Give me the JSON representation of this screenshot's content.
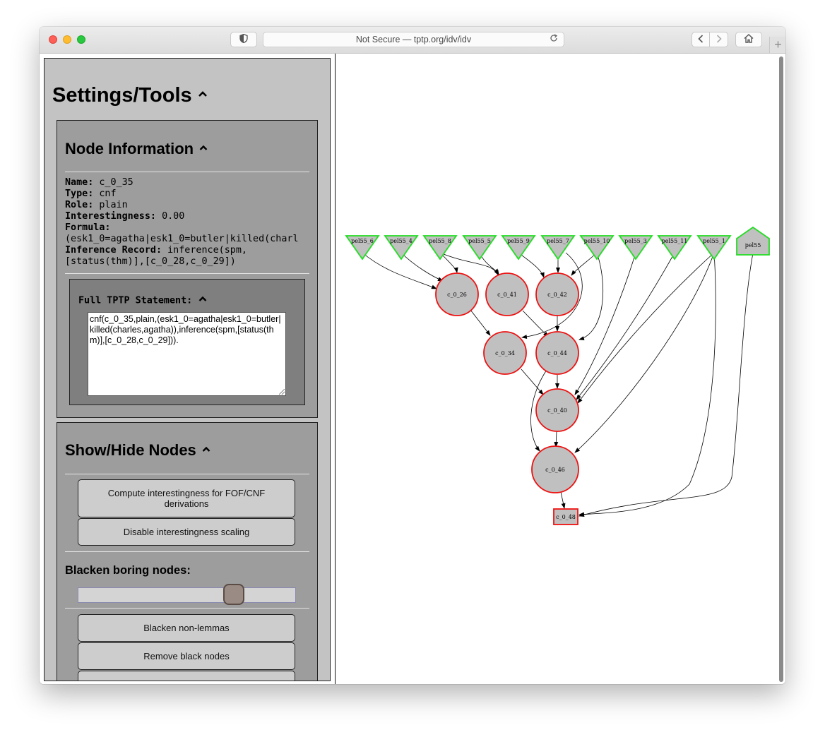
{
  "browser": {
    "url": "Not Secure — tptp.org/idv/idv",
    "shield_icon": "shield-icon",
    "reload_icon": "reload-icon",
    "back_icon": "chevron-left-icon",
    "forward_icon": "chevron-right-icon",
    "home_icon": "home-icon",
    "new_tab_label": "+"
  },
  "settings": {
    "title": "Settings/Tools",
    "node_info": {
      "title": "Node Information",
      "name_label": "Name:",
      "name_value": "c_0_35",
      "type_label": "Type:",
      "type_value": "cnf",
      "role_label": "Role:",
      "role_value": "plain",
      "interestingness_label": "Interestingness:",
      "interestingness_value": "0.00",
      "formula_label": "Formula:",
      "formula_value": "(esk1_0=agatha|esk1_0=butler|killed(charl",
      "inference_label": "Inference Record:",
      "inference_value_1": "inference(spm,",
      "inference_value_2": "[status(thm)],[c_0_28,c_0_29])",
      "full_tptp_title": "Full TPTP Statement:",
      "full_tptp_text": "cnf(c_0_35,plain,(esk1_0=agatha|esk1_0=butler|killed(charles,agatha)),inference(spm,[status(thm)],[c_0_28,c_0_29]))."
    },
    "show_hide": {
      "title": "Show/Hide Nodes",
      "compute_button": "Compute interestingness for FOF/CNF derivations",
      "disable_button": "Disable interestingness scaling",
      "blacken_label": "Blacken boring nodes:",
      "blacken_level_percent": 71,
      "blacken_nonlemmas_button": "Blacken non-lemmas",
      "remove_black_button": "Remove black nodes"
    }
  },
  "graph": {
    "top_nodes": [
      "pel55_6",
      "pel55_4",
      "pel55_8",
      "pel55_5",
      "pel55_9",
      "pel55_7",
      "pel55_10",
      "pel55_3",
      "pel55_11",
      "pel55_1"
    ],
    "conjecture_node": "pel55",
    "circle_nodes": [
      "c_0_26",
      "c_0_41",
      "c_0_42",
      "c_0_34",
      "c_0_44",
      "c_0_40",
      "c_0_46"
    ],
    "goal_node": "c_0_48",
    "colors": {
      "axiom_border": "#22dd22",
      "derived_border": "#ee1111",
      "node_fill": "#c0c0c0"
    }
  }
}
